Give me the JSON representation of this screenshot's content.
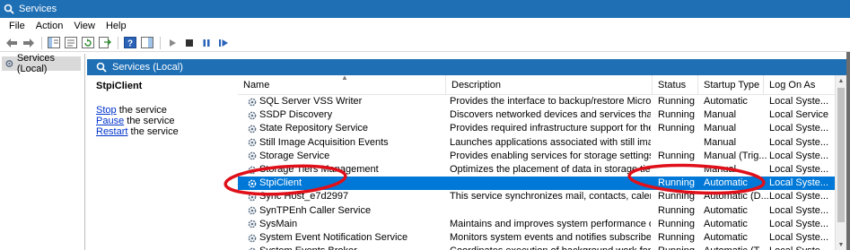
{
  "window": {
    "title": "Services",
    "app_icon": "services-gear-icon"
  },
  "menu": {
    "items": [
      "File",
      "Action",
      "View",
      "Help"
    ]
  },
  "toolbar": {
    "icons": [
      "back-arrow-icon",
      "forward-arrow-icon",
      "show-tree-icon",
      "properties-icon",
      "refresh-icon",
      "export-list-icon",
      "help-icon",
      "show-pane-icon",
      "start-service-icon",
      "stop-service-icon",
      "pause-service-icon",
      "restart-service-icon"
    ]
  },
  "tree": {
    "selected": "Services (Local)"
  },
  "pane": {
    "title": "Services (Local)"
  },
  "extended": {
    "service_name": "StpiClient",
    "actions": [
      {
        "link": "Stop",
        "rest": " the service"
      },
      {
        "link": "Pause",
        "rest": " the service"
      },
      {
        "link": "Restart",
        "rest": " the service"
      }
    ]
  },
  "columns": {
    "name": "Name",
    "description": "Description",
    "status": "Status",
    "startup": "Startup Type",
    "logon": "Log On As"
  },
  "services": [
    {
      "name": "SQL Server VSS Writer",
      "description": "Provides the interface to backup/restore Microsoft ...",
      "status": "Running",
      "startup": "Automatic",
      "logon": "Local Syste..."
    },
    {
      "name": "SSDP Discovery",
      "description": "Discovers networked devices and services that use ...",
      "status": "Running",
      "startup": "Manual",
      "logon": "Local Service"
    },
    {
      "name": "State Repository Service",
      "description": "Provides required infrastructure support for the ap...",
      "status": "Running",
      "startup": "Manual",
      "logon": "Local Syste..."
    },
    {
      "name": "Still Image Acquisition Events",
      "description": "Launches applications associated with still image a...",
      "status": "",
      "startup": "Manual",
      "logon": "Local Syste..."
    },
    {
      "name": "Storage Service",
      "description": "Provides enabling services for storage settings and ...",
      "status": "Running",
      "startup": "Manual (Trig...",
      "logon": "Local Syste..."
    },
    {
      "name": "Storage Tiers Management",
      "description": "Optimizes the placement of data in storage tiers on ...",
      "status": "",
      "startup": "Manual",
      "logon": "Local Syste..."
    },
    {
      "name": "StpiClient",
      "description": "",
      "status": "Running",
      "startup": "Automatic",
      "logon": "Local Syste..."
    },
    {
      "name": "Sync Host_e7d2997",
      "description": "This service synchronizes mail, contacts, calendar a...",
      "status": "Running",
      "startup": "Automatic (D...",
      "logon": "Local Syste..."
    },
    {
      "name": "SynTPEnh Caller Service",
      "description": "",
      "status": "Running",
      "startup": "Automatic",
      "logon": "Local Syste..."
    },
    {
      "name": "SysMain",
      "description": "Maintains and improves system performance over ...",
      "status": "Running",
      "startup": "Automatic",
      "logon": "Local Syste..."
    },
    {
      "name": "System Event Notification Service",
      "description": "Monitors system events and notifies subscribers to ...",
      "status": "Running",
      "startup": "Automatic",
      "logon": "Local Syste..."
    },
    {
      "name": "System Events Broker",
      "description": "Coordinates execution of background work for Win...",
      "status": "Running",
      "startup": "Automatic (T...",
      "logon": "Local Syste..."
    }
  ],
  "selected_row": 6,
  "colors": {
    "title_bar": "#1f6fb5",
    "selection": "#0078d7",
    "annotation": "#e0101a",
    "link": "#0033cc"
  }
}
